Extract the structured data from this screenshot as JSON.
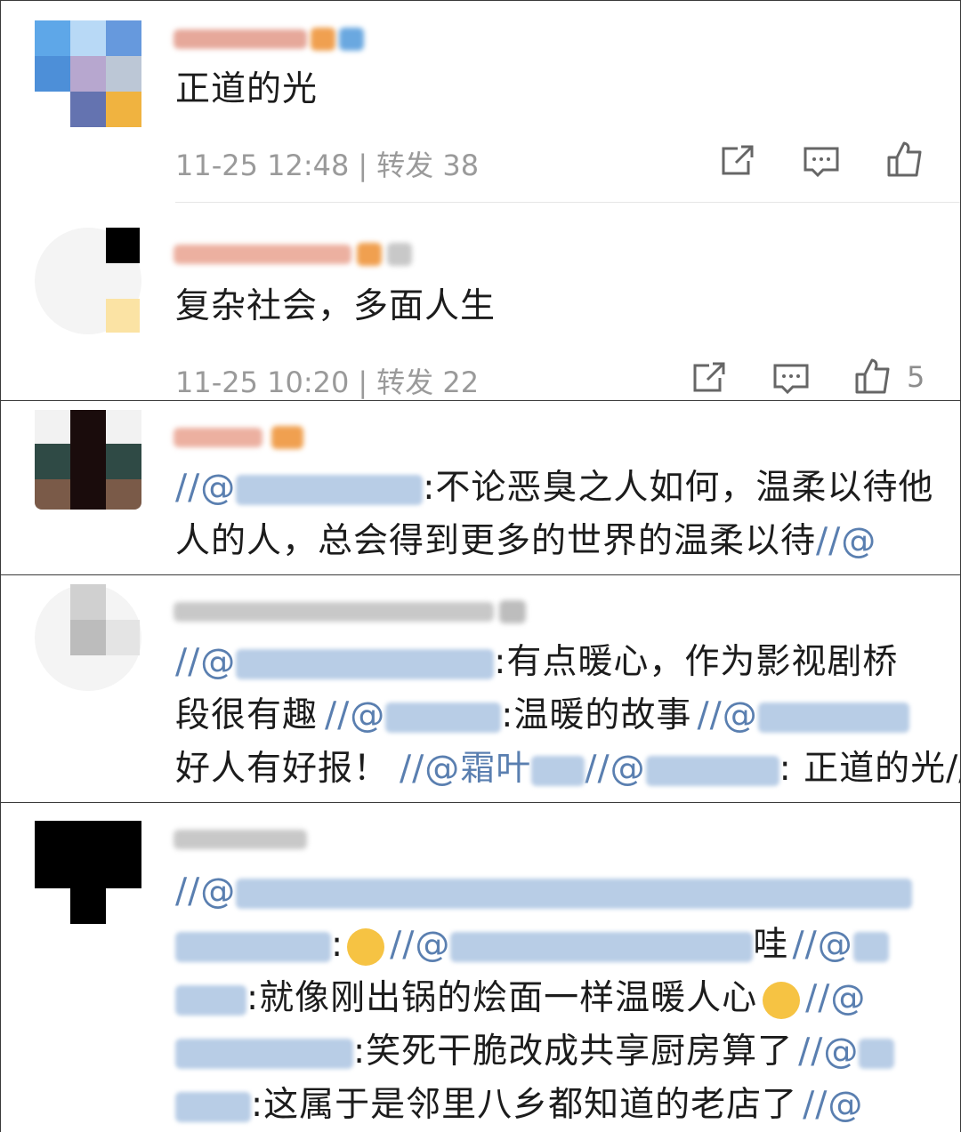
{
  "comments": [
    {
      "text": "正道的光",
      "time": "11-25 12:48",
      "repost": "转发 38",
      "likes": ""
    },
    {
      "text": "复杂社会，多面人生",
      "time": "11-25 10:20",
      "repost": "转发 22",
      "likes": "5"
    }
  ],
  "reposts": [
    {
      "lines": [
        ":不论恶臭之人如何，温柔以待他",
        "人的人，总会得到更多的世界的温柔以待",
        "//@"
      ]
    },
    {
      "lines": [
        ":有点暖心，作为影视剧桥",
        "段很有趣",
        ":温暖的故事",
        "好人有好报！",
        "霜叶",
        ": 正道的光"
      ]
    },
    {
      "lines": [
        "哇",
        ":就像刚出锅的烩面一样温暖人心",
        ":笑死干脆改成共享厨房算了",
        ":这属于是邻里八乡都知道的老店了"
      ]
    }
  ],
  "symbols": {
    "at": "//@",
    "slash": "//"
  },
  "icons": [
    "share-icon",
    "comment-icon",
    "like-icon"
  ],
  "colors": {
    "mention": "#5a7fb0",
    "meta": "#9a9a9a",
    "border": "#3a3a3a"
  }
}
